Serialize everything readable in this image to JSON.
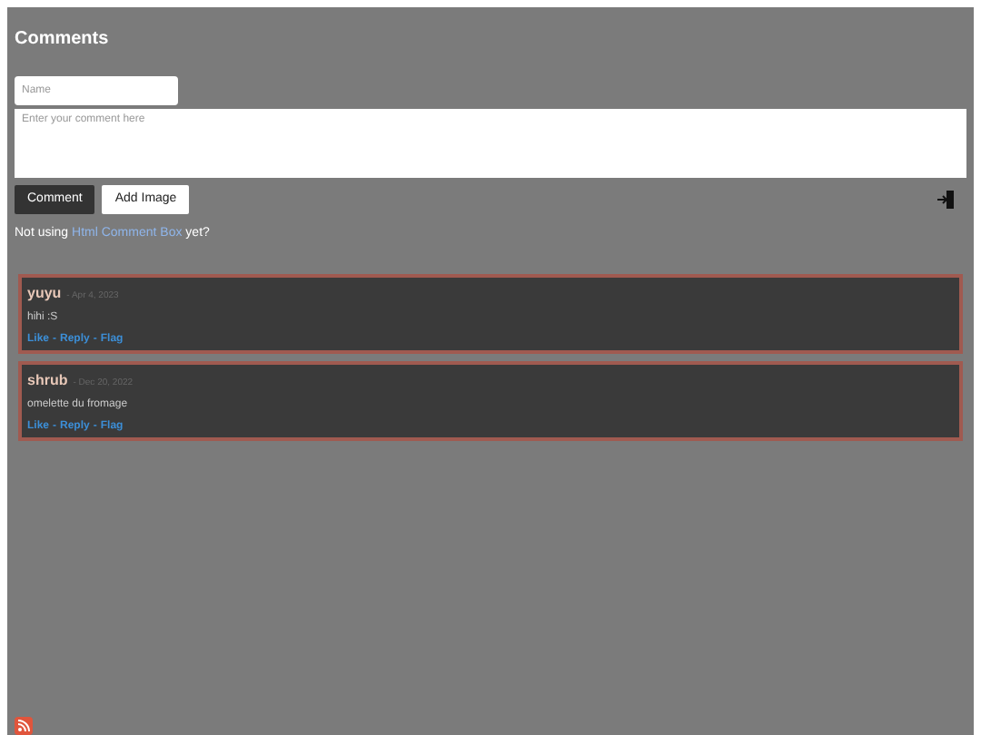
{
  "title": "Comments",
  "form": {
    "name_placeholder": "Name",
    "comment_placeholder": "Enter your comment here",
    "buttons": [
      "Comment",
      "Add Image"
    ]
  },
  "promo": {
    "before": "Not using",
    "link": "Html Comment Box",
    "after": "yet?"
  },
  "comments": [
    {
      "author": "yuyu",
      "date": "- Apr 4, 2023",
      "text": "hihi :S",
      "actions": [
        "Like",
        "-",
        "Reply",
        "-",
        "Flag"
      ]
    },
    {
      "author": "shrub",
      "date": "- Dec 20, 2022",
      "text": "omelette du fromage",
      "actions": [
        "Like",
        "-",
        "Reply",
        "-",
        "Flag"
      ]
    }
  ]
}
